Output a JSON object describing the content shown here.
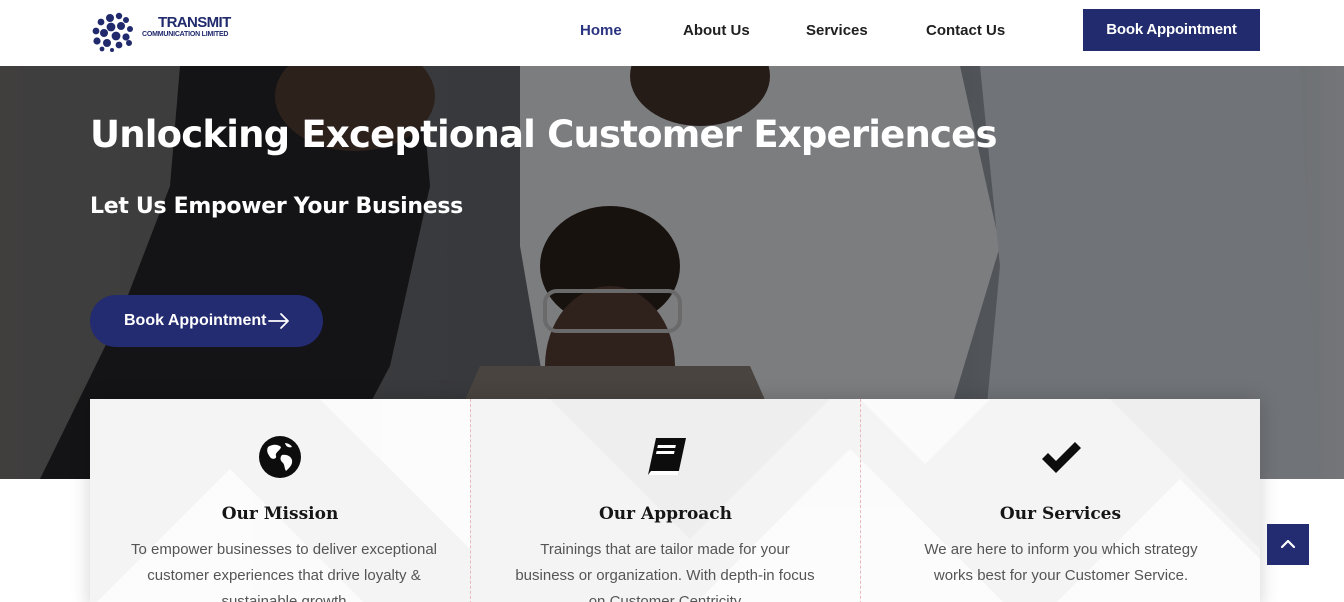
{
  "brand": {
    "name": "TRANSMIT",
    "tagline": "COMMUNICATION LIMITED",
    "color": "#212b6d"
  },
  "nav": {
    "items": [
      {
        "label": "Home",
        "active": true
      },
      {
        "label": "About Us",
        "active": false
      },
      {
        "label": "Services",
        "active": false
      },
      {
        "label": "Contact Us",
        "active": false
      }
    ],
    "cta_label": "Book Appointment"
  },
  "hero": {
    "title": "Unlocking Exceptional Customer Experiences",
    "subtitle": "Let Us Empower Your Business",
    "cta_label": "Book Appointment",
    "cta_icon": "arrow-right-icon"
  },
  "features": [
    {
      "icon": "globe-icon",
      "title": "Our Mission",
      "text": "To empower businesses to deliver exceptional customer experiences that drive loyalty & sustainable growth"
    },
    {
      "icon": "book-icon",
      "title": "Our Approach",
      "text": "Trainings that are tailor made for your business or organization. With depth-in focus on Customer Centricity"
    },
    {
      "icon": "checkmark-icon",
      "title": "Our Services",
      "text": "We are here to inform you which strategy works best for your Customer Service."
    }
  ],
  "scroll_top": {
    "icon": "chevron-up-icon"
  },
  "colors": {
    "accent": "#212b6d",
    "divider": "#e6b9bf",
    "text": "#555555"
  }
}
